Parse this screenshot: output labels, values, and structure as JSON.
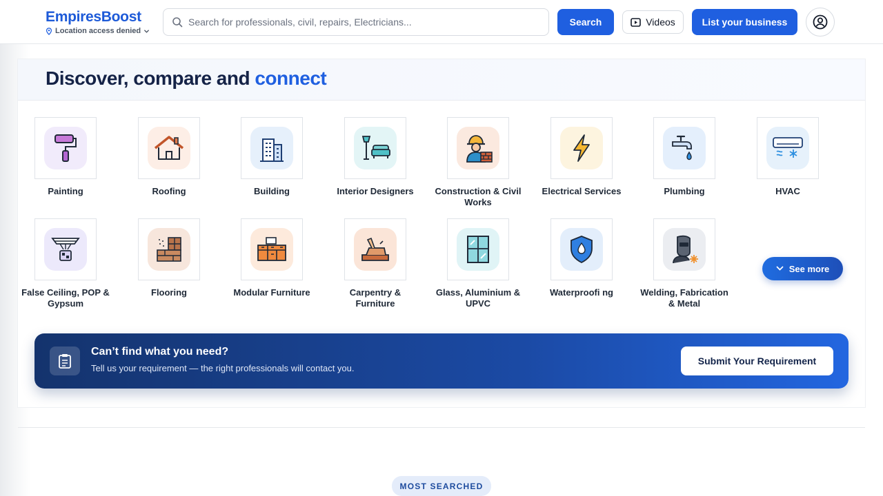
{
  "header": {
    "brand": "EmpiresBoost",
    "location_status": "Location access denied",
    "search_placeholder": "Search for professionals, civil, repairs, Electricians...",
    "search_button": "Search",
    "videos_button": "Videos",
    "list_business_button": "List your business"
  },
  "hero": {
    "title_main": "Discover, compare and ",
    "title_accent": "connect"
  },
  "categories": [
    {
      "label": "Painting",
      "icon": "paint-roller-icon"
    },
    {
      "label": "Roofing",
      "icon": "roof-house-icon"
    },
    {
      "label": "Building",
      "icon": "building-icon"
    },
    {
      "label": "Interior Designers",
      "icon": "lamp-sofa-icon"
    },
    {
      "label": "Construction & Civil Works",
      "icon": "construction-worker-icon"
    },
    {
      "label": "Electrical Services",
      "icon": "lightning-bolt-icon"
    },
    {
      "label": "Plumbing",
      "icon": "water-tap-icon"
    },
    {
      "label": "HVAC",
      "icon": "air-conditioner-icon"
    },
    {
      "label": "False Ceiling, POP & Gypsum",
      "icon": "ceiling-light-icon"
    },
    {
      "label": "Flooring",
      "icon": "floor-tiles-icon"
    },
    {
      "label": "Modular Furniture",
      "icon": "modular-cabinet-icon"
    },
    {
      "label": "Carpentry & Furniture",
      "icon": "wood-plane-icon"
    },
    {
      "label": "Glass, Aluminium & UPVC",
      "icon": "glass-window-icon"
    },
    {
      "label": "Waterproofi ng",
      "icon": "water-shield-icon"
    },
    {
      "label": "Welding, Fabrication & Metal",
      "icon": "welder-mask-icon"
    }
  ],
  "see_more": "See more",
  "cta": {
    "title": "Can’t find what you need?",
    "subtitle": "Tell us your requirement — the right professionals will contact you.",
    "button": "Submit Your Requirement"
  },
  "section_badge": "MOST SEARCHED",
  "colors": {
    "brand_blue": "#1f5fe0",
    "heading_navy": "#152347",
    "cta_gradient_start": "#14336d",
    "cta_gradient_end": "#2366e0"
  }
}
